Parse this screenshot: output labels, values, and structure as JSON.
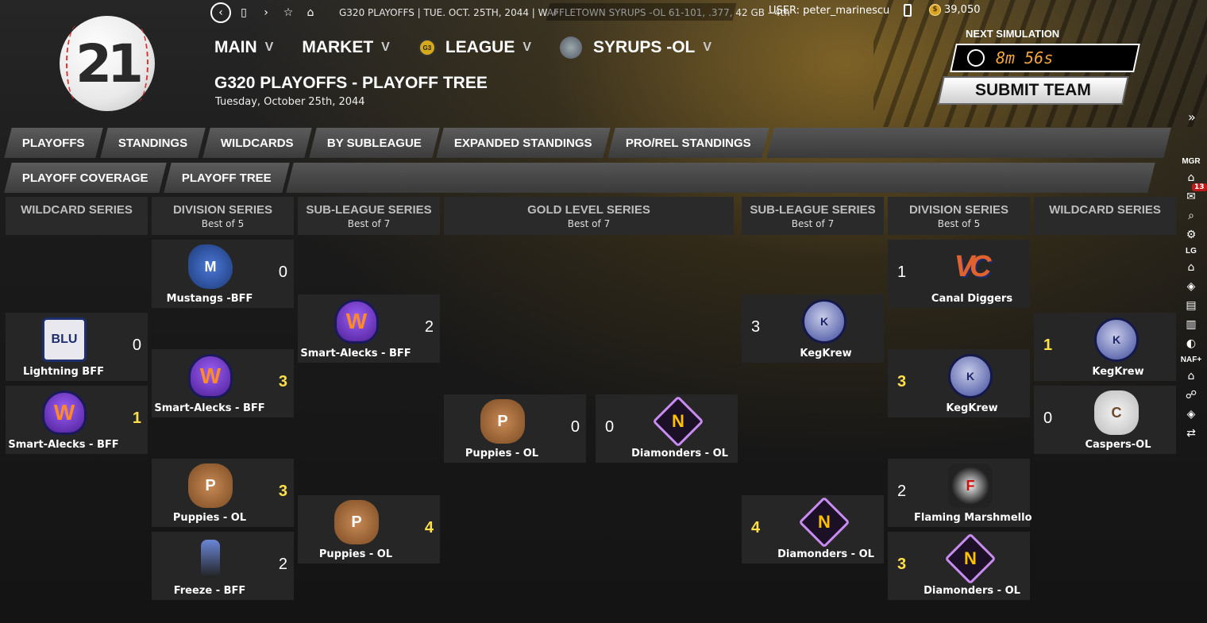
{
  "topbar": {
    "status": "G320 PLAYOFFS  |  TUE. OCT. 25TH, 2044  |  WAFFLETOWN SYRUPS -OL   61-101, .377, 42 GB - 4th",
    "user": "USER: peter_marinescu",
    "coins": "39,050"
  },
  "logo_text": "21",
  "menu": {
    "main": "MAIN",
    "market": "MARKET",
    "league": "LEAGUE",
    "league_badge": "G3",
    "team": "SYRUPS -OL"
  },
  "page": {
    "title": "G320 PLAYOFFS - PLAYOFF TREE",
    "date": "Tuesday, October 25th, 2044"
  },
  "sim": {
    "label": "NEXT SIMULATION",
    "time": "8m 56s",
    "submit": "SUBMIT TEAM"
  },
  "tabs_row1": [
    "PLAYOFFS",
    "STANDINGS",
    "WILDCARDS",
    "BY SUBLEAGUE",
    "EXPANDED STANDINGS",
    "PRO/REL STANDINGS"
  ],
  "tabs_row2": [
    "PLAYOFF COVERAGE",
    "PLAYOFF TREE"
  ],
  "sidebar": {
    "mgr": "MGR",
    "lg": "LG",
    "naf": "NAF+",
    "mail_count": "13"
  },
  "columns": [
    {
      "title": "WILDCARD SERIES",
      "sub": ""
    },
    {
      "title": "DIVISION SERIES",
      "sub": "Best of 5"
    },
    {
      "title": "SUB-LEAGUE SERIES",
      "sub": "Best of 7"
    },
    {
      "title": "GOLD LEVEL SERIES",
      "sub": "Best of 7"
    },
    {
      "title": "SUB-LEAGUE SERIES",
      "sub": "Best of 7"
    },
    {
      "title": "DIVISION SERIES",
      "sub": "Best of 5"
    },
    {
      "title": "WILDCARD SERIES",
      "sub": ""
    }
  ],
  "teams": {
    "wc_l1": {
      "name": "Lightning BFF",
      "score": "0",
      "logo": "BLU"
    },
    "wc_l2": {
      "name": "Smart-Alecks - BFF",
      "score": "1",
      "logo": "W"
    },
    "ds_l1": {
      "name": "Mustangs -BFF",
      "score": "0",
      "logo": "M"
    },
    "ds_l2": {
      "name": "Smart-Alecks - BFF",
      "score": "3",
      "logo": "W"
    },
    "ds_l3": {
      "name": "Puppies - OL",
      "score": "3",
      "logo": "P"
    },
    "ds_l4": {
      "name": "Freeze - BFF",
      "score": "2",
      "logo": ""
    },
    "sl_l1": {
      "name": "Smart-Alecks - BFF",
      "score": "2",
      "logo": "W"
    },
    "sl_l2": {
      "name": "Puppies - OL",
      "score": "4",
      "logo": "P"
    },
    "gl_l": {
      "name": "Puppies - OL",
      "score": "0",
      "logo": "P"
    },
    "gl_r": {
      "name": "Diamonders - OL",
      "score": "0",
      "logo": "N"
    },
    "sl_r1": {
      "name": "KegKrew",
      "score": "3",
      "logo": "K"
    },
    "sl_r2": {
      "name": "Diamonders - OL",
      "score": "4",
      "logo": "N"
    },
    "ds_r1": {
      "name": "Canal Diggers",
      "score": "1",
      "logo": "VC"
    },
    "ds_r2": {
      "name": "KegKrew",
      "score": "3",
      "logo": "K"
    },
    "ds_r3": {
      "name": "Flaming Marshmello",
      "score": "2",
      "logo": "F"
    },
    "ds_r4": {
      "name": "Diamonders - OL",
      "score": "3",
      "logo": "N"
    },
    "wc_r1": {
      "name": "KegKrew",
      "score": "1",
      "logo": "K"
    },
    "wc_r2": {
      "name": "Caspers-OL",
      "score": "0",
      "logo": "C"
    }
  }
}
